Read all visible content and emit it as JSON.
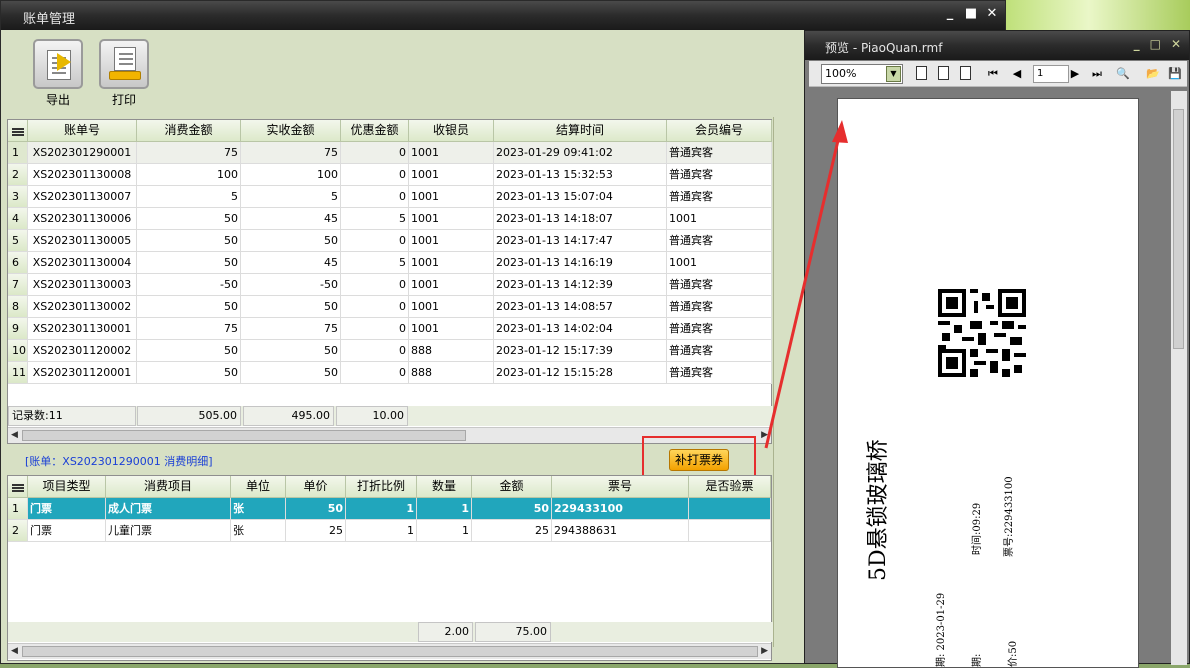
{
  "window": {
    "title": "账单管理",
    "min": "_",
    "max": "■",
    "close": "✕"
  },
  "toolbar": {
    "export_label": "导出",
    "print_label": "打印"
  },
  "bills": {
    "columns": [
      "账单号",
      "消费金额",
      "实收金额",
      "优惠金额",
      "收银员",
      "结算时间",
      "会员编号"
    ],
    "rows": [
      [
        "1",
        "XS202301290001",
        "75",
        "75",
        "0",
        "1001",
        "2023-01-29 09:41:02",
        "普通宾客"
      ],
      [
        "2",
        "XS202301130008",
        "100",
        "100",
        "0",
        "1001",
        "2023-01-13 15:32:53",
        "普通宾客"
      ],
      [
        "3",
        "XS202301130007",
        "5",
        "5",
        "0",
        "1001",
        "2023-01-13 15:07:04",
        "普通宾客"
      ],
      [
        "4",
        "XS202301130006",
        "50",
        "45",
        "5",
        "1001",
        "2023-01-13 14:18:07",
        "1001"
      ],
      [
        "5",
        "XS202301130005",
        "50",
        "50",
        "0",
        "1001",
        "2023-01-13 14:17:47",
        "普通宾客"
      ],
      [
        "6",
        "XS202301130004",
        "50",
        "45",
        "5",
        "1001",
        "2023-01-13 14:16:19",
        "1001"
      ],
      [
        "7",
        "XS202301130003",
        "-50",
        "-50",
        "0",
        "1001",
        "2023-01-13 14:12:39",
        "普通宾客"
      ],
      [
        "8",
        "XS202301130002",
        "50",
        "50",
        "0",
        "1001",
        "2023-01-13 14:08:57",
        "普通宾客"
      ],
      [
        "9",
        "XS202301130001",
        "75",
        "75",
        "0",
        "1001",
        "2023-01-13 14:02:04",
        "普通宾客"
      ],
      [
        "10",
        "XS202301120002",
        "50",
        "50",
        "0",
        "888",
        "2023-01-12 15:17:39",
        "普通宾客"
      ],
      [
        "11",
        "XS202301120001",
        "50",
        "50",
        "0",
        "888",
        "2023-01-12 15:15:28",
        "普通宾客"
      ]
    ],
    "footer": {
      "count": "记录数:11",
      "sum_amount": "505.00",
      "sum_received": "495.00",
      "sum_discount": "10.00"
    }
  },
  "detail": {
    "caption": "[账单：XS202301290001 消费明细]",
    "reprint_label": "补打票券",
    "columns": [
      "项目类型",
      "消费项目",
      "单位",
      "单价",
      "打折比例",
      "数量",
      "金额",
      "票号",
      "是否验票"
    ],
    "rows": [
      [
        "1",
        "门票",
        "成人门票",
        "张",
        "50",
        "1",
        "1",
        "50",
        "229433100",
        ""
      ],
      [
        "2",
        "门票",
        "儿童门票",
        "张",
        "25",
        "1",
        "1",
        "25",
        "294388631",
        ""
      ]
    ],
    "footer": {
      "sum_qty": "2.00",
      "sum_amount": "75.00"
    }
  },
  "preview": {
    "title": "预览 - PiaoQuan.rmf",
    "zoom": "100%",
    "page": "1",
    "ticket": {
      "name": "5D悬锁玻璃桥",
      "time": "时间:09:29",
      "ticket_no": "票号:229433100",
      "date": "期: 2023-01-29",
      "date2": "期:",
      "price": "价:50"
    }
  },
  "colors": {
    "selected_row": "#21a6bc",
    "highlight": "#e62e2e",
    "button": "#f3a100"
  }
}
